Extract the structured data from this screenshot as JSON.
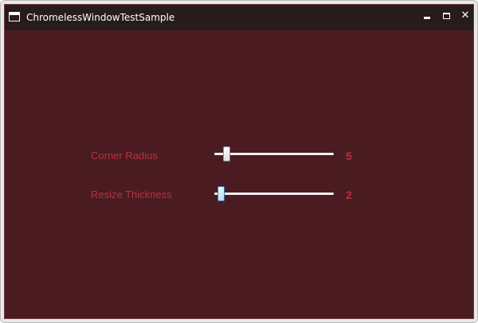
{
  "window": {
    "title": "ChromelessWindowTestSample",
    "icon": "app-window-icon",
    "controls": {
      "minimize_icon": "minimize-icon",
      "maximize_icon": "maximize-icon",
      "close_icon": "close-icon",
      "close_glyph": "✕"
    },
    "background_color": "#4a1c21",
    "titlebar_color": "#271b1c"
  },
  "settings": {
    "accent_color": "#b5323f",
    "corner_radius": {
      "label": "Corner Radius",
      "value": "5",
      "slider_fraction": 0.05
    },
    "resize_thickness": {
      "label": "Resize Thickness",
      "value": "2",
      "slider_fraction": 0.0
    }
  }
}
